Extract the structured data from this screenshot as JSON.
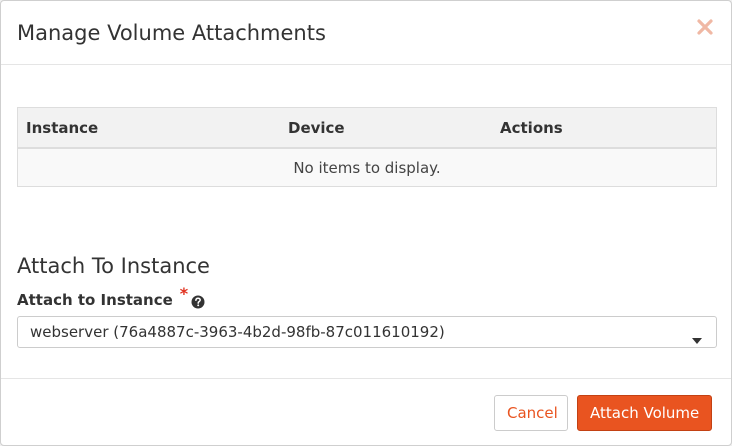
{
  "dialog": {
    "title": "Manage Volume Attachments",
    "close_icon": "close-icon"
  },
  "attachments_table": {
    "columns": [
      "Instance",
      "Device",
      "Actions"
    ],
    "rows": [],
    "empty_message": "No items to display."
  },
  "attach_section": {
    "title": "Attach To Instance",
    "field_label": "Attach to Instance",
    "required_marker": "*",
    "help_icon": "question-circle-icon",
    "selected_instance": "webserver (76a4887c-3963-4b2d-98fb-87c011610192)",
    "caret_icon": "caret-down-icon"
  },
  "footer": {
    "cancel_label": "Cancel",
    "submit_label": "Attach Volume"
  },
  "colors": {
    "accent": "#e95420",
    "required": "#e0301e",
    "table_header_bg": "#f2f2f2"
  }
}
